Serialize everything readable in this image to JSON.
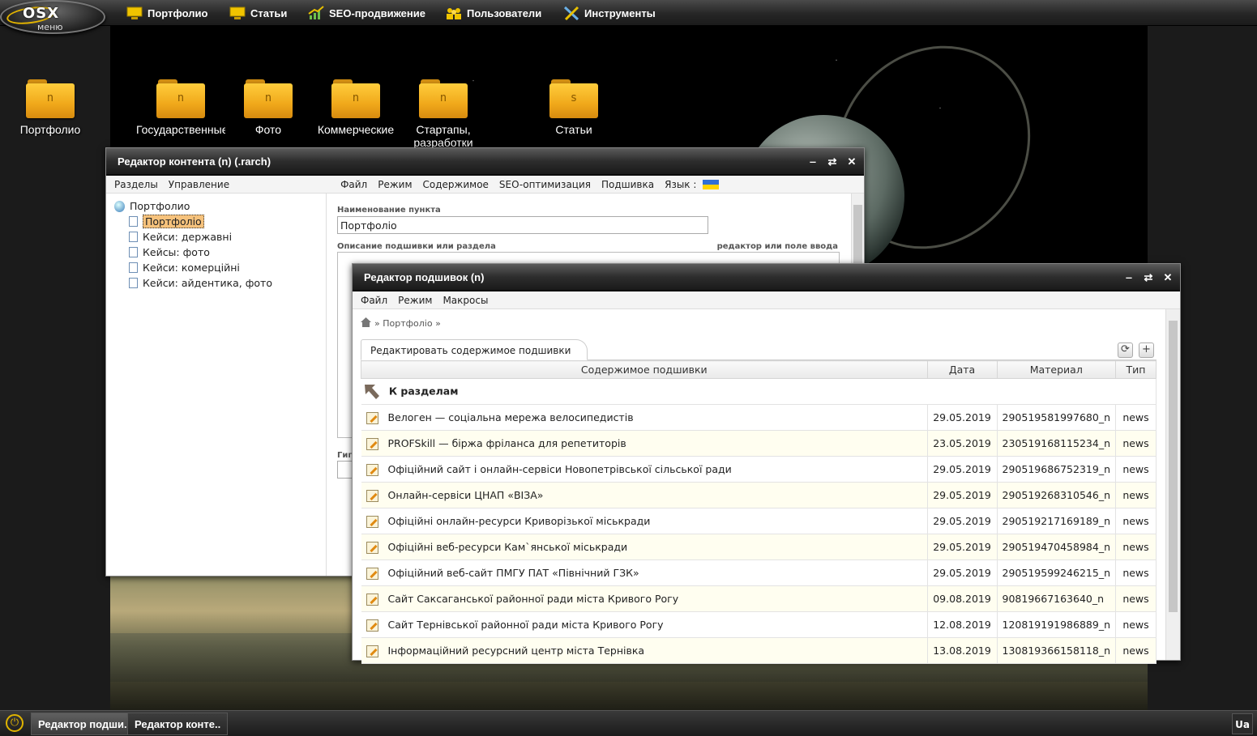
{
  "logo": {
    "brand": "OSX",
    "sub": "меню"
  },
  "topmenu": [
    {
      "label": "Портфолио",
      "icon": "monitor-icon"
    },
    {
      "label": "Статьи",
      "icon": "monitor-icon"
    },
    {
      "label": "SEO-продвижение",
      "icon": "chart-icon"
    },
    {
      "label": "Пользователи",
      "icon": "users-icon"
    },
    {
      "label": "Инструменты",
      "icon": "tools-icon"
    }
  ],
  "desktop_icons": [
    {
      "letter": "n",
      "label": "Портфолио"
    },
    {
      "letter": "n",
      "label": "Государственные"
    },
    {
      "letter": "n",
      "label": "Фото"
    },
    {
      "letter": "n",
      "label": "Коммерческие"
    },
    {
      "letter": "n",
      "label": "Стартапы, разработки"
    },
    {
      "letter": "s",
      "label": "Статьи"
    }
  ],
  "content_editor": {
    "title": "Редактор контента (n) (.rarch)",
    "left_menu": [
      "Разделы",
      "Управление"
    ],
    "right_menu": [
      "Файл",
      "Режим",
      "Содержимое",
      "SEO-оптимизация",
      "Подшивка",
      "Язык :"
    ],
    "tree_root": "Портфолио",
    "tree_items": [
      "Портфоліо",
      "Кейси: державні",
      "Кейсы: фото",
      "Кейси: комерційні",
      "Кейси: айдентика, фото"
    ],
    "field_name_label": "Наименование пункта",
    "field_name_value": "Портфоліо",
    "field_desc_label": "Описание подшивки или раздела",
    "field_desc_hint": "редактор или поле ввода",
    "cut_label": "Гиг"
  },
  "bindings_editor": {
    "title": "Редактор подшивок (n)",
    "menu": [
      "Файл",
      "Режим",
      "Макросы"
    ],
    "breadcrumb": "» Портфоліо »",
    "tab": "Редактировать содержимое подшивки",
    "columns": [
      "Содержимое подшивки",
      "Дата",
      "Материал",
      "Тип"
    ],
    "back_label": "К разделам",
    "rows": [
      {
        "title": "Велоген — соціальна мережа велосипедистів",
        "date": "29.05.2019",
        "material": "290519581997680_n",
        "type": "news"
      },
      {
        "title": "PROFSkill — біржа фріланса для репетиторів",
        "date": "23.05.2019",
        "material": "230519168115234_n",
        "type": "news"
      },
      {
        "title": "Офіційний сайт і онлайн-сервіси Новопетрівської сільської ради",
        "date": "29.05.2019",
        "material": "290519686752319_n",
        "type": "news"
      },
      {
        "title": "Онлайн-сервіси ЦНАП «ВІЗА»",
        "date": "29.05.2019",
        "material": "290519268310546_n",
        "type": "news"
      },
      {
        "title": "Офіційні онлайн-ресурси Криворізької міськради",
        "date": "29.05.2019",
        "material": "290519217169189_n",
        "type": "news"
      },
      {
        "title": "Офіційні веб-ресурси Кам`янської міськради",
        "date": "29.05.2019",
        "material": "290519470458984_n",
        "type": "news"
      },
      {
        "title": "Офіційний веб-сайт ПМГУ ПАТ «Північний ГЗК»",
        "date": "29.05.2019",
        "material": "290519599246215_n",
        "type": "news"
      },
      {
        "title": "Сайт Саксаганської районної ради міста Кривого Рогу",
        "date": "09.08.2019",
        "material": "90819667163640_n",
        "type": "news"
      },
      {
        "title": "Сайт Тернівської районної ради міста Кривого Рогу",
        "date": "12.08.2019",
        "material": "120819191986889_n",
        "type": "news"
      },
      {
        "title": "Інформаційний ресурсний центр міста Тернівка",
        "date": "13.08.2019",
        "material": "130819366158118_n",
        "type": "news"
      }
    ]
  },
  "taskbar": {
    "tasks": [
      "Редактор подши..",
      "Редактор конте.."
    ],
    "lang": "Ua"
  },
  "colors": {
    "accent": "#e0b400",
    "folder": "#f0a81a",
    "row_alt": "#fffef0"
  }
}
